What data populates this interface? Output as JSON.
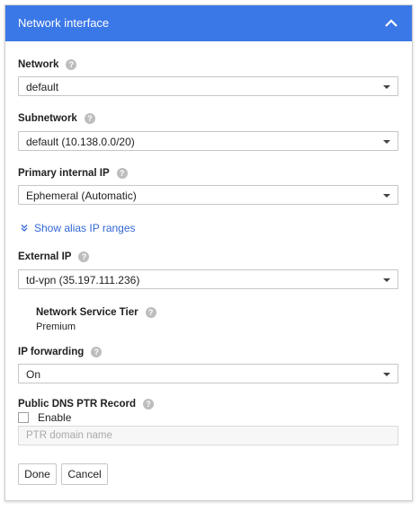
{
  "header": {
    "title": "Network interface"
  },
  "network": {
    "label": "Network",
    "value": "default"
  },
  "subnetwork": {
    "label": "Subnetwork",
    "value": "default (10.138.0.0/20)"
  },
  "primary_ip": {
    "label": "Primary internal IP",
    "value": "Ephemeral (Automatic)"
  },
  "alias_link": {
    "label": "Show alias IP ranges"
  },
  "external_ip": {
    "label": "External IP",
    "value": "td-vpn (35.197.111.236)"
  },
  "service_tier": {
    "label": "Network Service Tier",
    "value": "Premium"
  },
  "ip_forwarding": {
    "label": "IP forwarding",
    "value": "On"
  },
  "dns_ptr": {
    "label": "Public DNS PTR Record",
    "enable_label": "Enable",
    "placeholder": "PTR domain name"
  },
  "actions": {
    "done_label": "Done",
    "cancel_label": "Cancel"
  },
  "help_glyph": "?",
  "colors": {
    "header": "#3b78e7",
    "link": "#3367d6"
  }
}
